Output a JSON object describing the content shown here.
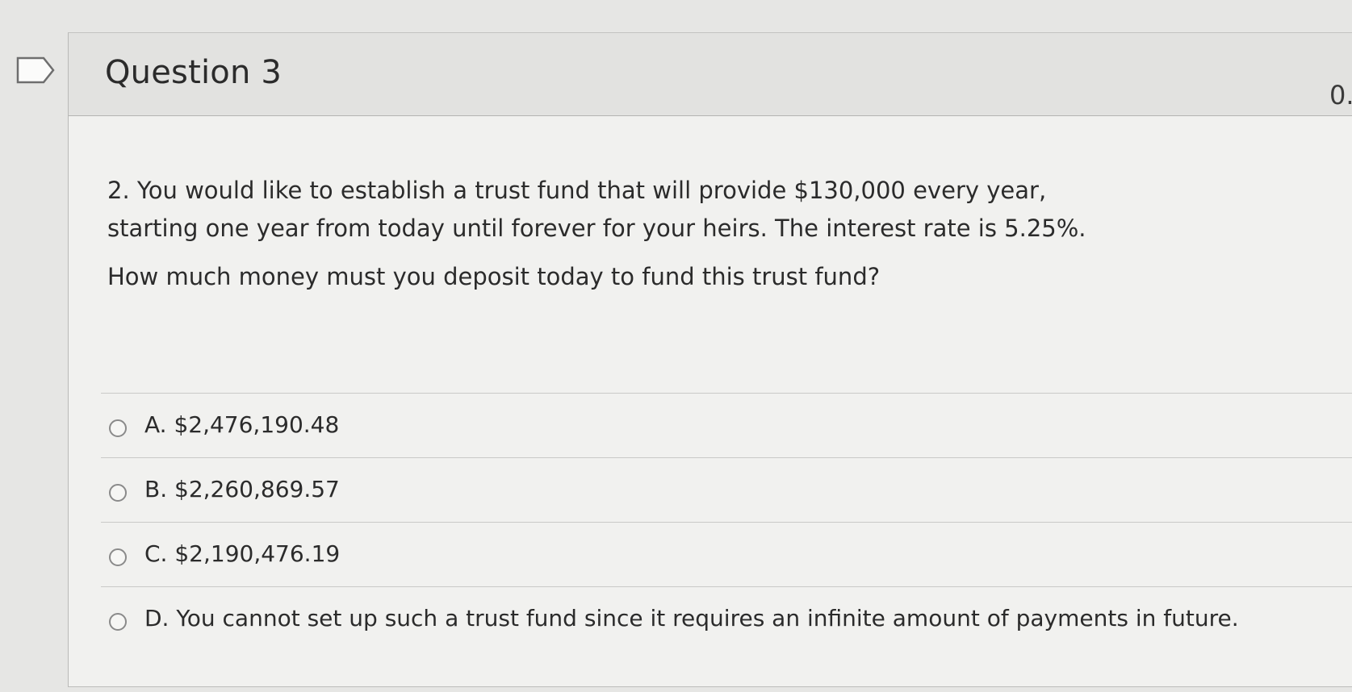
{
  "question": {
    "title": "Question 3",
    "points_partial": "0.",
    "text": "2. You would like to establish a trust fund that will provide $130,000 every year, starting one year from today until forever for your heirs. The interest rate is 5.25%.",
    "ask": "How much money must you deposit today to fund this trust fund?"
  },
  "answers": [
    {
      "label": "A. $2,476,190.48"
    },
    {
      "label": "B. $2,260,869.57"
    },
    {
      "label": "C. $2,190,476.19"
    },
    {
      "label": "D. You cannot set up such a trust fund since it requires an infinite amount of payments in future."
    }
  ],
  "icons": {
    "bookmark": "bookmark-flag-icon"
  }
}
